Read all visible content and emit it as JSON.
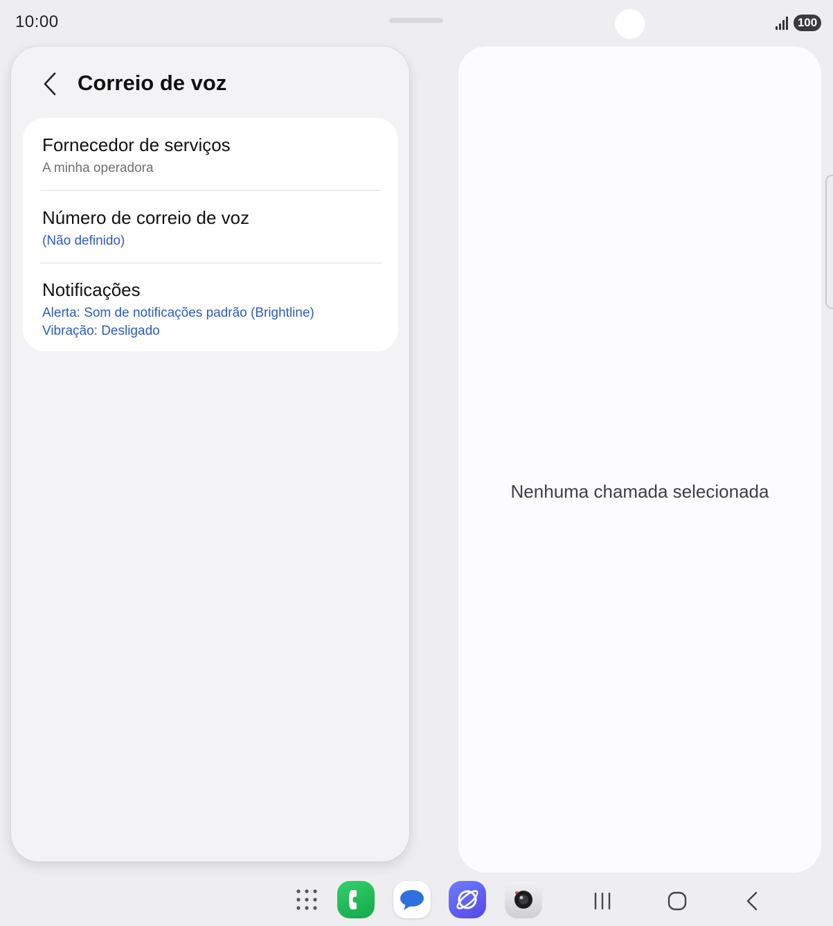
{
  "status_bar": {
    "time": "10:00",
    "battery_level": "100",
    "signal_icon": "signal-bars-icon"
  },
  "left_panel": {
    "header": {
      "back_icon": "chevron-left-icon",
      "title": "Correio de voz"
    },
    "settings": [
      {
        "title": "Fornecedor de serviços",
        "subtitle": "A minha operadora",
        "subtitle_color": "#6f6f72"
      },
      {
        "title": "Número de correio de voz",
        "subtitle": "(Não definido)",
        "subtitle_color": "#2d5bbf"
      },
      {
        "title": "Notificações",
        "subtitle": "Alerta: Som de notificações padrão (Brightline)",
        "subtitle2": "Vibração: Desligado",
        "subtitle_color": "#2d5bbf"
      }
    ]
  },
  "right_panel": {
    "empty_message": "Nenhuma chamada selecionada"
  },
  "taskbar": {
    "apps": [
      "apps-grid-icon",
      "phone-app-icon",
      "messages-app-icon",
      "internet-app-icon",
      "camera-app-icon"
    ],
    "nav": [
      "recents-icon",
      "home-icon",
      "back-icon"
    ]
  },
  "colors": {
    "background": "#eeeef0",
    "panel": "#f3f3f5",
    "card": "#ffffff",
    "link_blue": "#2d5bbf"
  }
}
